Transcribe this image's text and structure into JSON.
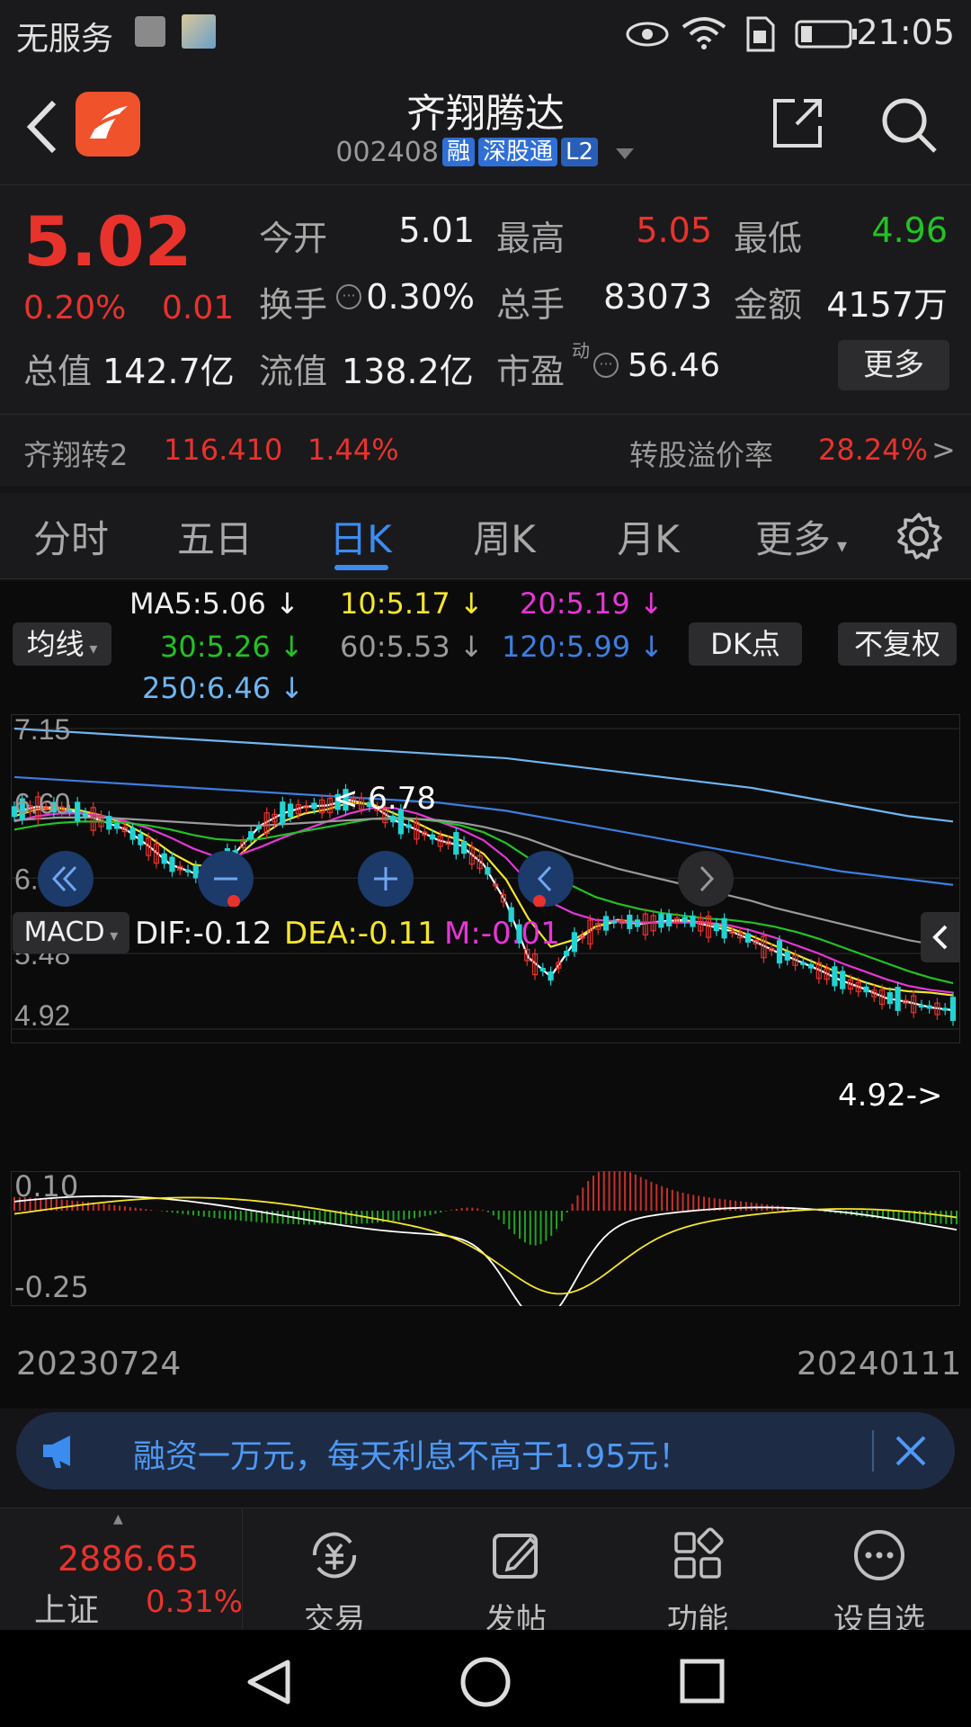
{
  "status_bar": {
    "carrier": "无服务",
    "time": "21:05"
  },
  "header": {
    "stock_name": "齐翔腾达",
    "stock_code": "002408",
    "tags": [
      "融",
      "深股通",
      "L2"
    ]
  },
  "quote": {
    "price": "5.02",
    "change_pct": "0.20%",
    "change_amt": "0.01",
    "open_label": "今开",
    "open": "5.01",
    "high_label": "最高",
    "high": "5.05",
    "low_label": "最低",
    "low": "4.96",
    "turnover_label": "换手",
    "turnover": "0.30%",
    "volume_label": "总手",
    "volume": "83073",
    "amount_label": "金额",
    "amount": "4157万",
    "total_cap_label": "总值",
    "total_cap": "142.7亿",
    "float_cap_label": "流值",
    "float_cap": "138.2亿",
    "pe_label": "市盈",
    "pe_sup": "动",
    "pe": "56.46",
    "more_label": "更多"
  },
  "convertible": {
    "name": "齐翔转2",
    "price": "116.410",
    "pct": "1.44%",
    "premium_label": "转股溢价率",
    "premium": "28.24%",
    "arrow": ">"
  },
  "tabs": [
    "分时",
    "五日",
    "日K",
    "周K",
    "月K",
    "更多"
  ],
  "ma_legend": {
    "ma5": "MA5:5.06 ↓",
    "ma10": "10:5.17 ↓",
    "ma20": "20:5.19 ↓",
    "ma30": "30:5.26 ↓",
    "ma60": "60:5.53 ↓",
    "ma120": "120:5.99 ↓",
    "ma250": "250:6.46 ↓",
    "ma_button": "均线",
    "dk_button": "DK点",
    "fq_button": "不复权"
  },
  "colors": {
    "up": "#e8332c",
    "down": "#22d3d3",
    "ma5": "#ffffff",
    "ma10": "#f5e62a",
    "ma20": "#e636d6",
    "ma30": "#22c322",
    "ma60": "#9a9a9a",
    "ma120": "#3c7fe0",
    "ma250": "#6fb6f0"
  },
  "chart_data": {
    "type": "line",
    "price_axis_ticks": [
      "7.15",
      "6.60",
      "6.04",
      "5.48",
      "4.92"
    ],
    "ylim": [
      4.92,
      7.15
    ],
    "annotations": {
      "high_marker": "< 6.78",
      "low_marker": "4.92->"
    },
    "macd": {
      "label": "MACD",
      "dif": "DIF:-0.12",
      "dea": "DEA:-0.11",
      "m": "M:-0.01",
      "axis_ticks": [
        "0.10",
        "-0.25"
      ]
    },
    "x_start": "20230724",
    "x_end": "20240111",
    "series": [
      {
        "name": "MA5",
        "values": [
          6.53,
          6.57,
          6.56,
          6.52,
          6.46,
          6.4,
          6.28,
          6.14,
          6.08,
          6.09,
          6.25,
          6.43,
          6.52,
          6.57,
          6.58,
          6.62,
          6.58,
          6.47,
          6.4,
          6.32,
          6.28,
          6.14,
          5.86,
          5.45,
          5.31,
          5.55,
          5.68,
          5.72,
          5.7,
          5.72,
          5.73,
          5.69,
          5.65,
          5.58,
          5.5,
          5.43,
          5.36,
          5.28,
          5.22,
          5.15,
          5.12,
          5.08,
          5.06
        ]
      },
      {
        "name": "MA10",
        "values": [
          6.5,
          6.55,
          6.56,
          6.54,
          6.5,
          6.44,
          6.35,
          6.23,
          6.14,
          6.12,
          6.2,
          6.35,
          6.46,
          6.52,
          6.55,
          6.6,
          6.59,
          6.52,
          6.45,
          6.37,
          6.32,
          6.22,
          6.03,
          5.74,
          5.53,
          5.58,
          5.68,
          5.73,
          5.71,
          5.71,
          5.72,
          5.71,
          5.67,
          5.61,
          5.54,
          5.47,
          5.4,
          5.33,
          5.27,
          5.22,
          5.2,
          5.19,
          5.17
        ]
      },
      {
        "name": "MA20",
        "values": [
          6.46,
          6.5,
          6.52,
          6.52,
          6.5,
          6.46,
          6.41,
          6.34,
          6.26,
          6.2,
          6.21,
          6.27,
          6.34,
          6.4,
          6.46,
          6.52,
          6.56,
          6.56,
          6.52,
          6.46,
          6.4,
          6.32,
          6.19,
          6.01,
          5.86,
          5.78,
          5.73,
          5.72,
          5.71,
          5.71,
          5.71,
          5.71,
          5.69,
          5.65,
          5.6,
          5.54,
          5.48,
          5.41,
          5.35,
          5.29,
          5.24,
          5.21,
          5.19
        ]
      },
      {
        "name": "MA30",
        "values": [
          6.4,
          6.43,
          6.45,
          6.46,
          6.46,
          6.45,
          6.43,
          6.4,
          6.36,
          6.33,
          6.32,
          6.33,
          6.36,
          6.39,
          6.42,
          6.45,
          6.48,
          6.49,
          6.48,
          6.46,
          6.43,
          6.38,
          6.3,
          6.19,
          6.07,
          5.98,
          5.9,
          5.85,
          5.81,
          5.78,
          5.76,
          5.74,
          5.73,
          5.71,
          5.68,
          5.64,
          5.59,
          5.53,
          5.47,
          5.41,
          5.35,
          5.3,
          5.26
        ]
      },
      {
        "name": "MA60",
        "values": [
          6.47,
          6.48,
          6.49,
          6.49,
          6.49,
          6.48,
          6.47,
          6.46,
          6.45,
          6.44,
          6.43,
          6.43,
          6.44,
          6.45,
          6.46,
          6.47,
          6.48,
          6.48,
          6.48,
          6.47,
          6.45,
          6.42,
          6.38,
          6.33,
          6.27,
          6.21,
          6.16,
          6.11,
          6.07,
          6.03,
          5.99,
          5.95,
          5.91,
          5.87,
          5.82,
          5.78,
          5.74,
          5.7,
          5.66,
          5.62,
          5.58,
          5.55,
          5.53
        ]
      },
      {
        "name": "MA120",
        "values": [
          6.79,
          6.78,
          6.77,
          6.76,
          6.75,
          6.74,
          6.73,
          6.72,
          6.71,
          6.7,
          6.69,
          6.68,
          6.67,
          6.66,
          6.65,
          6.64,
          6.63,
          6.62,
          6.61,
          6.6,
          6.58,
          6.56,
          6.54,
          6.51,
          6.48,
          6.45,
          6.42,
          6.39,
          6.36,
          6.33,
          6.3,
          6.27,
          6.24,
          6.21,
          6.18,
          6.15,
          6.12,
          6.09,
          6.07,
          6.05,
          6.03,
          6.01,
          5.99
        ]
      },
      {
        "name": "MA250",
        "values": [
          7.15,
          7.14,
          7.13,
          7.12,
          7.11,
          7.1,
          7.09,
          7.08,
          7.07,
          7.06,
          7.05,
          7.04,
          7.03,
          7.02,
          7.01,
          7.0,
          6.99,
          6.98,
          6.97,
          6.96,
          6.95,
          6.94,
          6.93,
          6.91,
          6.89,
          6.87,
          6.85,
          6.83,
          6.81,
          6.79,
          6.77,
          6.75,
          6.73,
          6.71,
          6.68,
          6.65,
          6.62,
          6.59,
          6.56,
          6.53,
          6.5,
          6.48,
          6.46
        ]
      }
    ]
  },
  "chart_controls": [
    "scroll-left-fast",
    "zoom-out",
    "zoom-in",
    "scroll-left",
    "scroll-right"
  ],
  "banner": {
    "text": "融资一万元，每天利息不高于1.95元！"
  },
  "bottom_bar": {
    "index_value": "2886.65",
    "index_name": "上证",
    "index_pct": "0.31%",
    "items": [
      "交易",
      "发帖",
      "功能",
      "设自选"
    ]
  }
}
